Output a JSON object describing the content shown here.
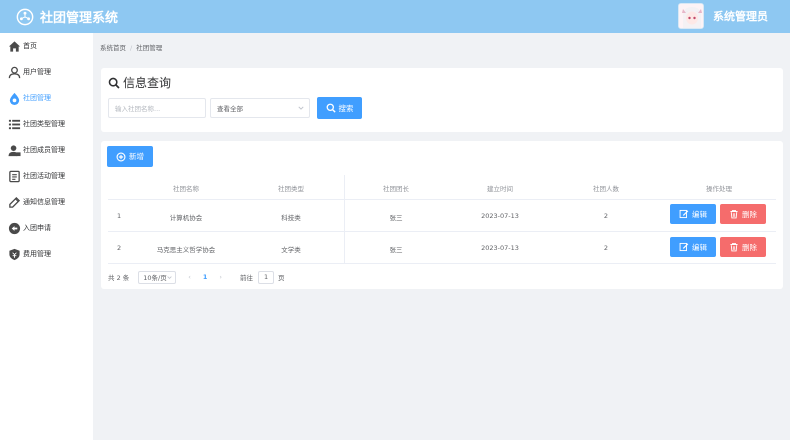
{
  "header": {
    "title": "社团管理系统",
    "user_name": "系统管理员"
  },
  "sidebar": {
    "items": [
      {
        "label": "首页",
        "icon": "home-icon"
      },
      {
        "label": "用户管理",
        "icon": "user-icon"
      },
      {
        "label": "社团管理",
        "icon": "drop-icon",
        "active": true
      },
      {
        "label": "社团类型管理",
        "icon": "list-icon"
      },
      {
        "label": "社团成员管理",
        "icon": "member-icon"
      },
      {
        "label": "社团活动管理",
        "icon": "activity-icon"
      },
      {
        "label": "通知信息管理",
        "icon": "notice-icon"
      },
      {
        "label": "入团申请",
        "icon": "apply-icon"
      },
      {
        "label": "费用管理",
        "icon": "money-icon"
      }
    ]
  },
  "breadcrumb": {
    "home": "系统首页",
    "separator": "/",
    "current": "社团管理"
  },
  "search": {
    "title": "信息查询",
    "name_placeholder": "输入社团名称...",
    "type_select_value": "查看全部",
    "search_button": "搜索"
  },
  "toolbar": {
    "add_button": "新增"
  },
  "table": {
    "columns": [
      "社团名称",
      "社团类型",
      "社团团长",
      "建立时间",
      "社团人数",
      "操作处理"
    ],
    "rows": [
      {
        "index": "1",
        "name": "计算机协会",
        "type": "科技类",
        "leader": "张三",
        "created": "2023-07-13",
        "members": "2"
      },
      {
        "index": "2",
        "name": "马克思主义哲学协会",
        "type": "文学类",
        "leader": "张三",
        "created": "2023-07-13",
        "members": "2"
      }
    ],
    "edit_button": "编辑",
    "delete_button": "删除"
  },
  "pagination": {
    "total": "共 2 条",
    "page_size": "10条/页",
    "prev": "‹",
    "current_page": "1",
    "next": "›",
    "goto_label": "前往",
    "goto_value": "1",
    "unit": "页"
  },
  "colors": {
    "header_bg": "#8ec8f2",
    "primary": "#409eff",
    "danger": "#f56c6c",
    "page_bg": "#f0f2f5"
  }
}
